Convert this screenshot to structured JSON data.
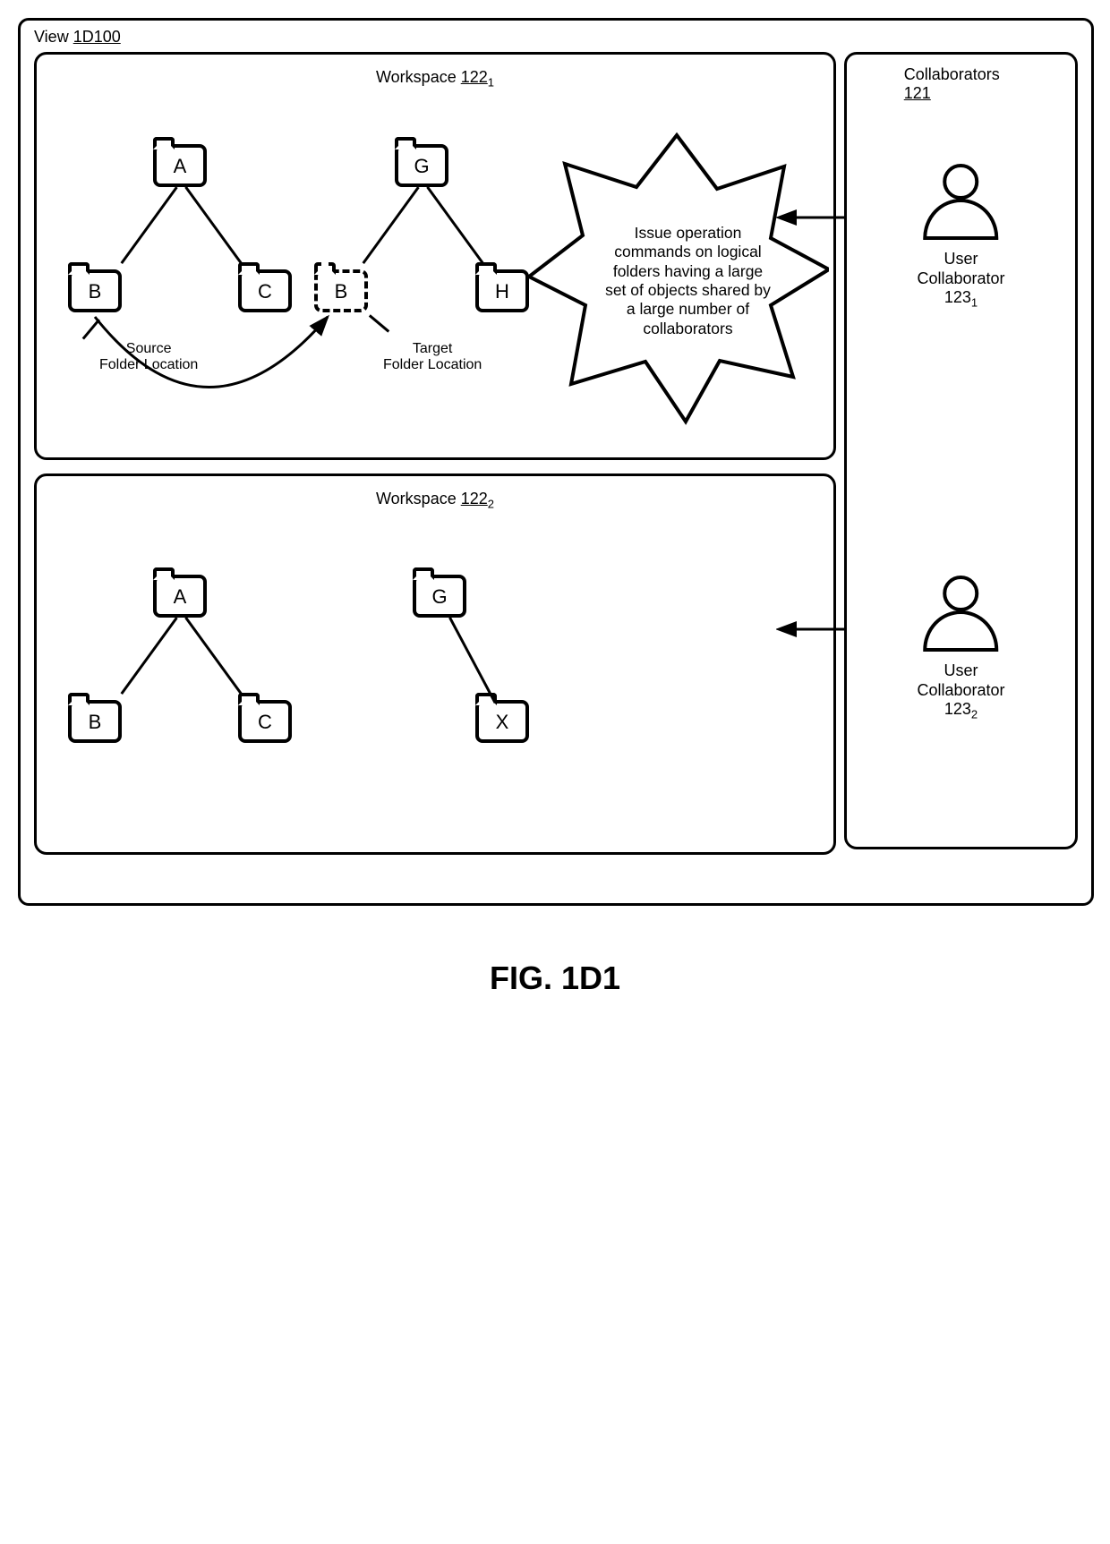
{
  "view_label_prefix": "View ",
  "view_label_under": "1D100",
  "workspace_prefix": "Workspace ",
  "workspace1_ref_base": "122",
  "workspace1_ref_sub": "1",
  "workspace2_ref_base": "122",
  "workspace2_ref_sub": "2",
  "ws1": {
    "folders": {
      "A": "A",
      "B": "B",
      "C": "C",
      "G": "G",
      "H": "H",
      "B2": "B"
    },
    "source_label": "Source\nFolder Location",
    "target_label": "Target\nFolder Location",
    "star_text": "Issue operation commands on logical folders having a large set of objects shared by a large number of collaborators"
  },
  "ws2": {
    "folders": {
      "A": "A",
      "B": "B",
      "C": "C",
      "G": "G",
      "X": "X"
    }
  },
  "collaborators": {
    "title_prefix": "Collaborators ",
    "title_ref": "121",
    "user_label": "User\nCollaborator ",
    "user1_ref_base": "123",
    "user1_ref_sub": "1",
    "user2_ref_base": "123",
    "user2_ref_sub": "2"
  },
  "figure_label": "FIG. 1D1"
}
